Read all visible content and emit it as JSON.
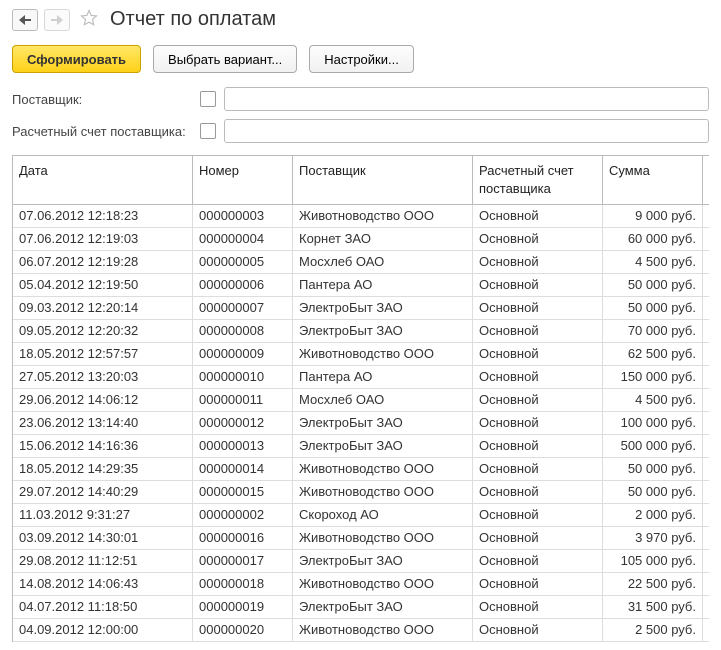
{
  "nav": {
    "back_enabled": true,
    "forward_enabled": false
  },
  "title": "Отчет по оплатам",
  "toolbar": {
    "generate": "Сформировать",
    "variant": "Выбрать вариант...",
    "settings": "Настройки..."
  },
  "filters": {
    "supplier_label": "Поставщик:",
    "supplier_value": "",
    "account_label": "Расчетный счет поставщика:",
    "account_value": ""
  },
  "columns": {
    "date": "Дата",
    "number": "Номер",
    "supplier": "Поставщик",
    "account": "Расчетный счет поставщика",
    "sum": "Сумма"
  },
  "rows": [
    {
      "date": "07.06.2012 12:18:23",
      "number": "000000003",
      "supplier": "Животноводство ООО",
      "account": "Основной",
      "sum": "9 000 руб."
    },
    {
      "date": "07.06.2012 12:19:03",
      "number": "000000004",
      "supplier": "Корнет ЗАО",
      "account": "Основной",
      "sum": "60 000 руб."
    },
    {
      "date": "06.07.2012 12:19:28",
      "number": "000000005",
      "supplier": "Мосхлеб ОАО",
      "account": "Основной",
      "sum": "4 500 руб."
    },
    {
      "date": "05.04.2012 12:19:50",
      "number": "000000006",
      "supplier": "Пантера АО",
      "account": "Основной",
      "sum": "50 000 руб."
    },
    {
      "date": "09.03.2012 12:20:14",
      "number": "000000007",
      "supplier": "ЭлектроБыт ЗАО",
      "account": "Основной",
      "sum": "50 000 руб."
    },
    {
      "date": "09.05.2012 12:20:32",
      "number": "000000008",
      "supplier": "ЭлектроБыт ЗАО",
      "account": "Основной",
      "sum": "70 000 руб."
    },
    {
      "date": "18.05.2012 12:57:57",
      "number": "000000009",
      "supplier": "Животноводство ООО",
      "account": "Основной",
      "sum": "62 500 руб."
    },
    {
      "date": "27.05.2012 13:20:03",
      "number": "000000010",
      "supplier": "Пантера АО",
      "account": "Основной",
      "sum": "150 000 руб."
    },
    {
      "date": "29.06.2012 14:06:12",
      "number": "000000011",
      "supplier": "Мосхлеб ОАО",
      "account": "Основной",
      "sum": "4 500 руб."
    },
    {
      "date": "23.06.2012 13:14:40",
      "number": "000000012",
      "supplier": "ЭлектроБыт ЗАО",
      "account": "Основной",
      "sum": "100 000 руб."
    },
    {
      "date": "15.06.2012 14:16:36",
      "number": "000000013",
      "supplier": "ЭлектроБыт ЗАО",
      "account": "Основной",
      "sum": "500 000 руб."
    },
    {
      "date": "18.05.2012 14:29:35",
      "number": "000000014",
      "supplier": "Животноводство ООО",
      "account": "Основной",
      "sum": "50 000 руб."
    },
    {
      "date": "29.07.2012 14:40:29",
      "number": "000000015",
      "supplier": "Животноводство ООО",
      "account": "Основной",
      "sum": "50 000 руб."
    },
    {
      "date": "11.03.2012 9:31:27",
      "number": "000000002",
      "supplier": "Скороход АО",
      "account": "Основной",
      "sum": "2 000 руб."
    },
    {
      "date": "03.09.2012 14:30:01",
      "number": "000000016",
      "supplier": "Животноводство ООО",
      "account": "Основной",
      "sum": "3 970 руб."
    },
    {
      "date": "29.08.2012 11:12:51",
      "number": "000000017",
      "supplier": "ЭлектроБыт ЗАО",
      "account": "Основной",
      "sum": "105 000 руб."
    },
    {
      "date": "14.08.2012 14:06:43",
      "number": "000000018",
      "supplier": "Животноводство ООО",
      "account": "Основной",
      "sum": "22 500 руб."
    },
    {
      "date": "04.07.2012 11:18:50",
      "number": "000000019",
      "supplier": "ЭлектроБыт ЗАО",
      "account": "Основной",
      "sum": "31 500 руб."
    },
    {
      "date": "04.09.2012 12:00:00",
      "number": "000000020",
      "supplier": "Животноводство ООО",
      "account": "Основной",
      "sum": "2 500 руб."
    }
  ]
}
